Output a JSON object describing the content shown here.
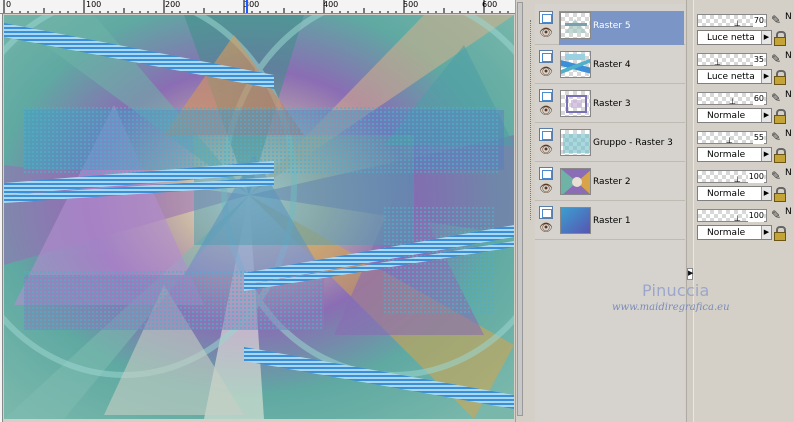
{
  "ruler": {
    "labels": [
      "0",
      "100",
      "200",
      "300",
      "400",
      "500",
      "600"
    ],
    "marker_color": "#1e5aff"
  },
  "canvas": {
    "colors": [
      "#6fb3a7",
      "#8a6db4",
      "#d7a44a",
      "#3f9fc7",
      "#c8cfc4",
      "#3a7fbf"
    ]
  },
  "layers": [
    {
      "name": "Raster 5",
      "selected": true,
      "opacity": "70",
      "opacity_fraction": 0.7,
      "blend": "Luce netta",
      "thumb": "transparent-shapes"
    },
    {
      "name": "Raster 4",
      "selected": false,
      "opacity": "35",
      "opacity_fraction": 0.35,
      "blend": "Luce netta",
      "thumb": "stripes"
    },
    {
      "name": "Raster 3",
      "selected": false,
      "opacity": "60",
      "opacity_fraction": 0.6,
      "blend": "Normale",
      "thumb": "transparent-frame"
    },
    {
      "name": "Gruppo - Raster 3",
      "selected": false,
      "opacity": "55",
      "opacity_fraction": 0.55,
      "blend": "Normale",
      "thumb": "transparent-teal"
    },
    {
      "name": "Raster 2",
      "selected": false,
      "opacity": "100",
      "opacity_fraction": 1.0,
      "blend": "Normale",
      "thumb": "multicolor"
    },
    {
      "name": "Raster 1",
      "selected": false,
      "opacity": "100",
      "opacity_fraction": 1.0,
      "blend": "Normale",
      "thumb": "gradient"
    }
  ],
  "icons": {
    "layer_type": "raster-layer-icon",
    "visibility": "eye-icon",
    "edit": "pen-icon",
    "lock": "lock-icon",
    "expand": "chevron-right-icon"
  },
  "cut_letter": "N",
  "watermark": {
    "title": "Pinuccia",
    "url": "www.maidiregrafica.eu"
  }
}
